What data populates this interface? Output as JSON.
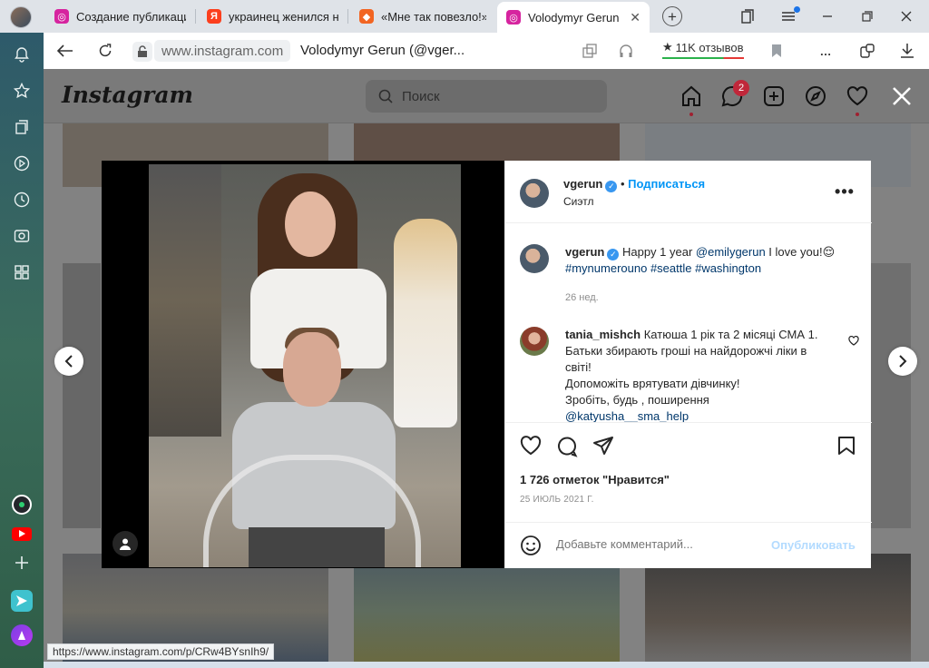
{
  "browser": {
    "tabs": [
      {
        "title": "Создание публикаци",
        "favicon_color": "#d6249f"
      },
      {
        "title": "украинец женился н",
        "favicon_color": "#fc3f1d"
      },
      {
        "title": "«Мне так повезло!»",
        "favicon_color": "#f26522"
      },
      {
        "title": "Volodymyr Gerun",
        "favicon_color": "#d6249f"
      }
    ],
    "url_host": "www.instagram.com",
    "page_title": "Volodymyr Gerun (@vger...",
    "reviews": "11K отзывов",
    "status_url": "https://www.instagram.com/p/CRw4BYsnIh9/"
  },
  "instagram": {
    "logo": "Instagram",
    "search_placeholder": "Поиск",
    "direct_badge": "2"
  },
  "post": {
    "username": "vgerun",
    "follow_label": "Подписаться",
    "location": "Сиэтл",
    "caption_user": "vgerun",
    "caption_text": "Happy 1 year ",
    "caption_mention": "@emilygerun",
    "caption_text2": " I love you!",
    "caption_emoji": "😌",
    "caption_tags": "#mynumerouno #seattle #washington",
    "caption_age": "26 нед.",
    "comment_user": "tania_mishch",
    "comment_text": "Катюша 1 рік та 2 місяці СМА 1. Батьки збирають гроші на найдорожчі ліки в світі!",
    "comment_text2": "Допоможіть врятувати дівчинку!",
    "comment_text3": "Зробіть, будь , поширення",
    "comment_mention": "@katyusha__sma_help",
    "likes": "1 726 отметок \"Нравится\"",
    "date": "25 ИЮЛЬ 2021 Г.",
    "comment_placeholder": "Добавьте комментарий...",
    "publish_label": "Опубликовать"
  }
}
